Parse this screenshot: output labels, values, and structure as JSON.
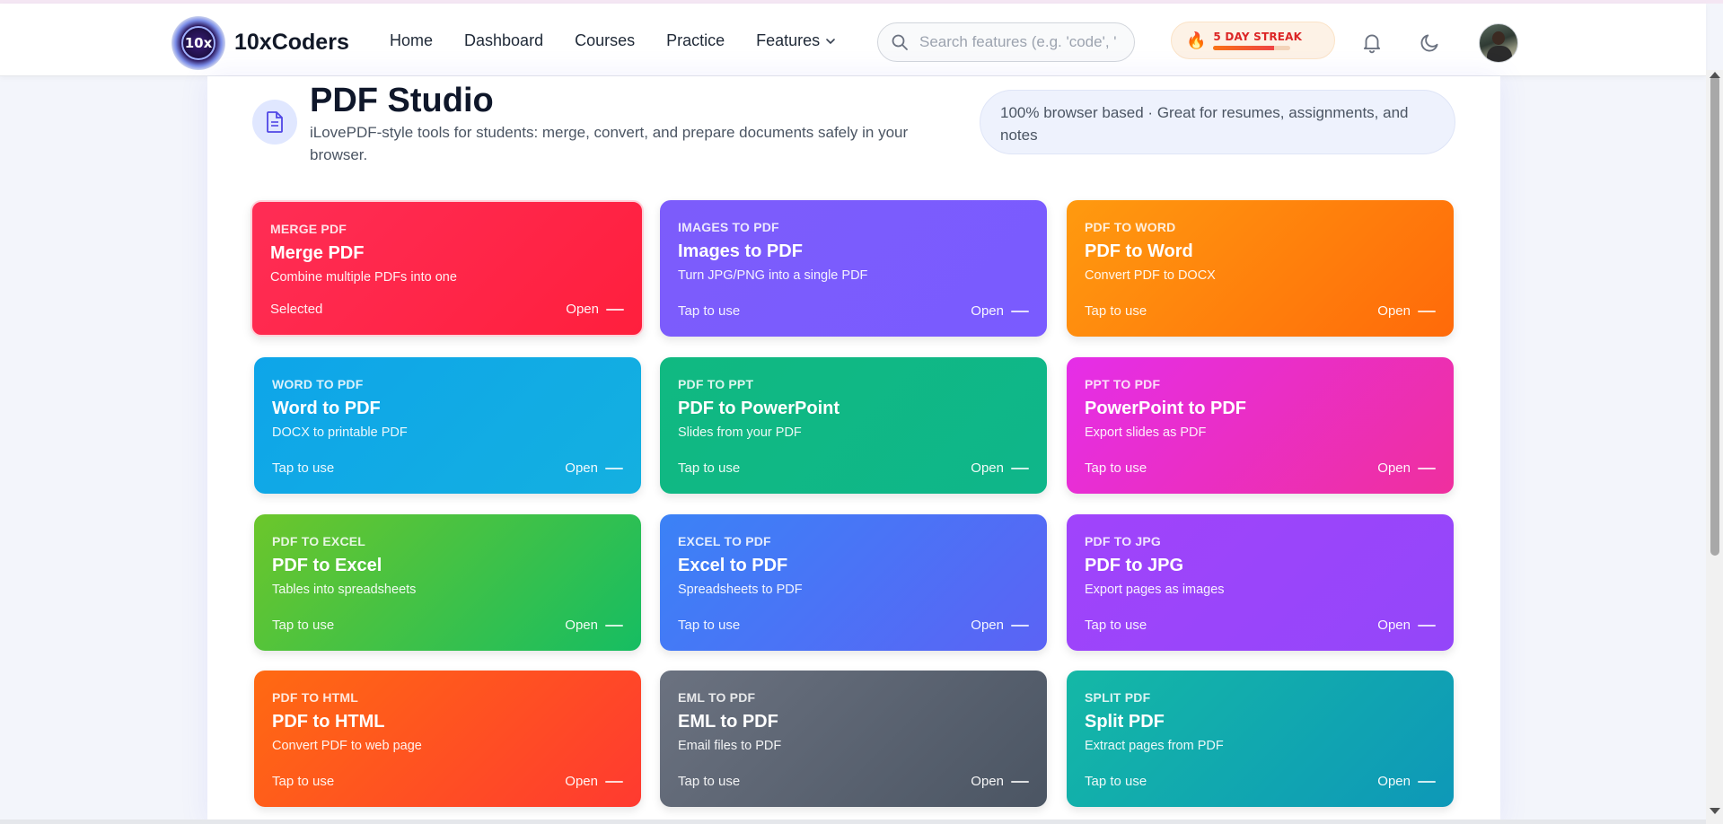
{
  "brand": {
    "name": "10xCoders",
    "logo_text": "10x"
  },
  "nav": {
    "home": "Home",
    "dashboard": "Dashboard",
    "courses": "Courses",
    "practice": "Practice",
    "features": "Features"
  },
  "search": {
    "placeholder": "Search features (e.g. 'code', '"
  },
  "streak": {
    "label": "5 DAY STREAK",
    "progress": 0.78,
    "accent": "#dc2626"
  },
  "page": {
    "title": "PDF Studio",
    "subtitle": "iLovePDF-style tools for students: merge, convert, and prepare documents safely in your browser.",
    "pill": "100% browser based · Great for resumes, assignments, and notes"
  },
  "cards": [
    {
      "kicker": "MERGE PDF",
      "title": "Merge PDF",
      "desc": "Combine multiple PDFs into one",
      "status": "Selected",
      "action": "Open",
      "colors": [
        "#ff2d55",
        "#ff1f3d"
      ]
    },
    {
      "kicker": "IMAGES TO PDF",
      "title": "Images to PDF",
      "desc": "Turn JPG/PNG into a single PDF",
      "status": "Tap to use",
      "action": "Open",
      "colors": [
        "#7c5cfb",
        "#7a5bff"
      ]
    },
    {
      "kicker": "PDF TO WORD",
      "title": "PDF to Word",
      "desc": "Convert PDF to DOCX",
      "status": "Tap to use",
      "action": "Open",
      "colors": [
        "#ff9a0f",
        "#ff6a0a"
      ]
    },
    {
      "kicker": "WORD TO PDF",
      "title": "Word to PDF",
      "desc": "DOCX to printable PDF",
      "status": "Tap to use",
      "action": "Open",
      "colors": [
        "#0ea5e9",
        "#14b0e0"
      ]
    },
    {
      "kicker": "PDF TO PPT",
      "title": "PDF to PowerPoint",
      "desc": "Slides from your PDF",
      "status": "Tap to use",
      "action": "Open",
      "colors": [
        "#10b981",
        "#0fb68a"
      ]
    },
    {
      "kicker": "PPT TO PDF",
      "title": "PowerPoint to PDF",
      "desc": "Export slides as PDF",
      "status": "Tap to use",
      "action": "Open",
      "colors": [
        "#e52ee8",
        "#ef2f9e"
      ]
    },
    {
      "kicker": "PDF TO EXCEL",
      "title": "PDF to Excel",
      "desc": "Tables into spreadsheets",
      "status": "Tap to use",
      "action": "Open",
      "colors": [
        "#6cc62b",
        "#16bd62"
      ]
    },
    {
      "kicker": "EXCEL TO PDF",
      "title": "Excel to PDF",
      "desc": "Spreadsheets to PDF",
      "status": "Tap to use",
      "action": "Open",
      "colors": [
        "#3b82f6",
        "#5b63f5"
      ]
    },
    {
      "kicker": "PDF TO JPG",
      "title": "PDF to JPG",
      "desc": "Export pages as images",
      "status": "Tap to use",
      "action": "Open",
      "colors": [
        "#a044fb",
        "#9446f9"
      ]
    },
    {
      "kicker": "PDF TO HTML",
      "title": "PDF to HTML",
      "desc": "Convert PDF to web page",
      "status": "Tap to use",
      "action": "Open",
      "colors": [
        "#ff6a12",
        "#ff3a30"
      ]
    },
    {
      "kicker": "EML TO PDF",
      "title": "EML to PDF",
      "desc": "Email files to PDF",
      "status": "Tap to use",
      "action": "Open",
      "colors": [
        "#6b7280",
        "#4b5563"
      ]
    },
    {
      "kicker": "SPLIT PDF",
      "title": "Split PDF",
      "desc": "Extract pages from PDF",
      "status": "Tap to use",
      "action": "Open",
      "colors": [
        "#14b8a6",
        "#0e98b8"
      ]
    }
  ]
}
